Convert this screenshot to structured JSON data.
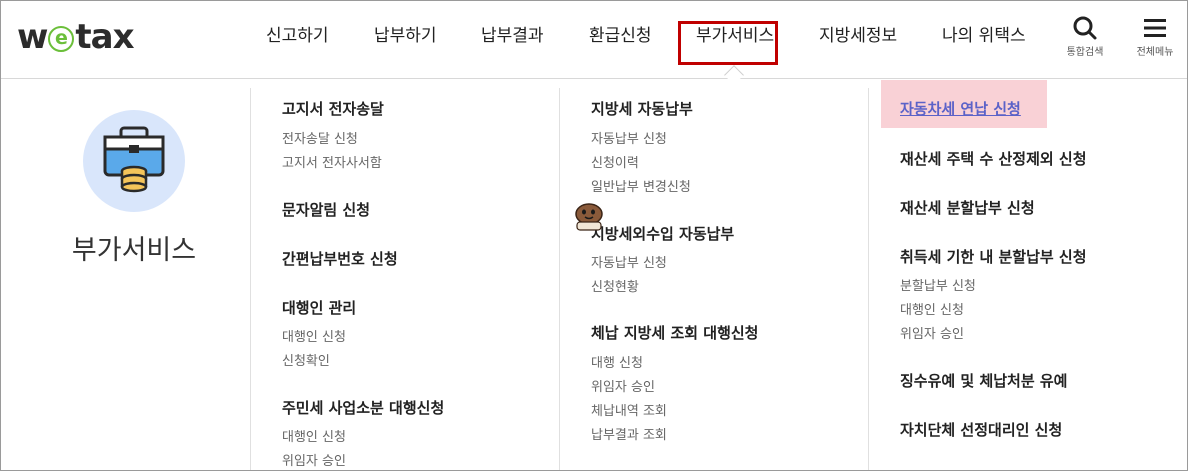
{
  "logo": {
    "part1": "w",
    "part2": "e",
    "part3": "tax"
  },
  "nav": {
    "items": [
      "신고하기",
      "납부하기",
      "납부결과",
      "환급신청",
      "부가서비스",
      "지방세정보",
      "나의 위택스"
    ],
    "active_index": 4,
    "active_color": "#c00000"
  },
  "utility": {
    "search_label": "통합검색",
    "menu_label": "전체메뉴"
  },
  "section": {
    "title": "부가서비스",
    "icon": "briefcase-coins-icon"
  },
  "col1": {
    "g1": {
      "title": "고지서 전자송달",
      "links": [
        "전자송달 신청",
        "고지서 전자사서함"
      ]
    },
    "g2": {
      "title": "문자알림 신청"
    },
    "g3": {
      "title": "간편납부번호 신청"
    },
    "g4": {
      "title": "대행인 관리",
      "links": [
        "대행인 신청",
        "신청확인"
      ]
    },
    "g5": {
      "title": "주민세 사업소분 대행신청",
      "links": [
        "대행인 신청",
        "위임자 승인"
      ]
    }
  },
  "col2": {
    "g1": {
      "title": "지방세 자동납부",
      "links": [
        "자동납부 신청",
        "신청이력",
        "일반납부 변경신청"
      ]
    },
    "g2": {
      "title": "지방세외수입 자동납부",
      "links": [
        "자동납부 신청",
        "신청현황"
      ]
    },
    "g3": {
      "title": "체납 지방세 조회 대행신청",
      "links": [
        "대행 신청",
        "위임자 승인",
        "체납내역 조회",
        "납부결과 조회"
      ]
    }
  },
  "col3": {
    "g1": {
      "title": "자동차세 연납 신청",
      "highlight_color": "#f9d1d6"
    },
    "g2": {
      "title": "재산세 주택 수 산정제외 신청"
    },
    "g3": {
      "title": "재산세 분할납부 신청"
    },
    "g4": {
      "title": "취득세 기한 내 분할납부 신청",
      "links": [
        "분할납부 신청",
        "대행인 신청",
        "위임자 승인"
      ]
    },
    "g5": {
      "title": "징수유예 및 체납처분 유예"
    },
    "g6": {
      "title": "자치단체 선정대리인 신청"
    }
  },
  "colors": {
    "brand_green": "#6bbf3a",
    "icon_circle": "#d9e6fb",
    "link_purple": "#5b62c8"
  }
}
